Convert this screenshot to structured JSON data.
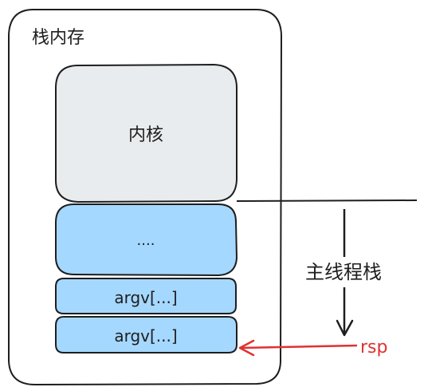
{
  "container": {
    "title": "栈内存"
  },
  "blocks": [
    {
      "label": "内核",
      "fill": "#e9ecef"
    },
    {
      "label": "....",
      "fill": "#a5d8ff"
    },
    {
      "label": "argv[...]",
      "fill": "#a5d8ff"
    },
    {
      "label": "argv[...]",
      "fill": "#a5d8ff"
    }
  ],
  "annotations": {
    "stack_label": "主线程栈",
    "pointer_label": "rsp"
  },
  "colors": {
    "stroke": "#1e1e1e",
    "pointer": "#e03131"
  }
}
